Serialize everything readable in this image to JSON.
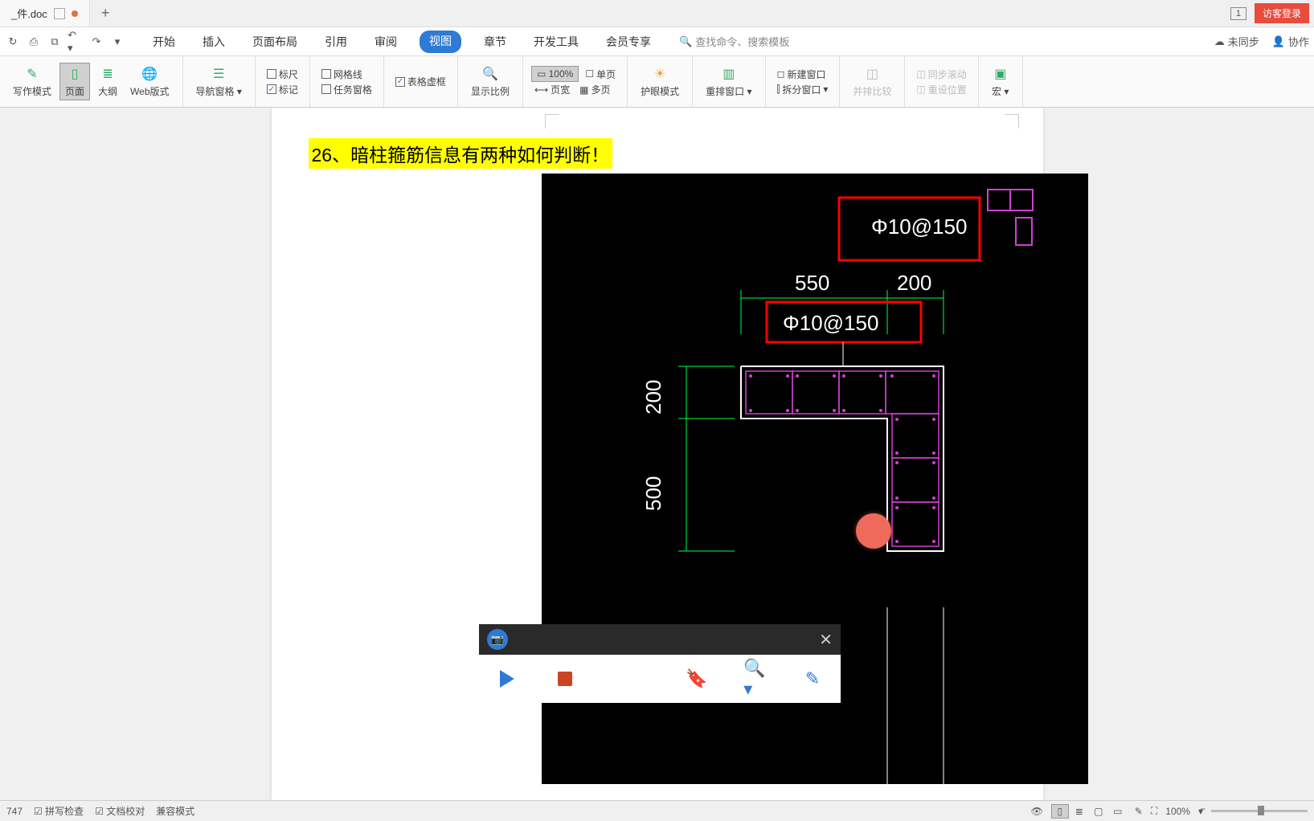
{
  "tab": {
    "filename": "_件.doc"
  },
  "login_btn": "访客登录",
  "badge1": "1",
  "menu": {
    "tabs": [
      "开始",
      "插入",
      "页面布局",
      "引用",
      "审阅",
      "视图",
      "章节",
      "开发工具",
      "会员专享"
    ],
    "active_index": 5,
    "search_placeholder": "查找命令、搜索模板",
    "unsync": "未同步",
    "collab": "协作"
  },
  "ribbon": {
    "write_mode": "写作模式",
    "page": "页面",
    "outline": "大纲",
    "web": "Web版式",
    "nav_pane": "导航窗格",
    "ruler": "标尺",
    "grid": "网格线",
    "table_dashed": "表格虚框",
    "markup": "标记",
    "task_pane": "任务窗格",
    "zoom_ratio": "显示比例",
    "zoom_value": "100%",
    "single_page": "单页",
    "page_width": "页宽",
    "multi_page": "多页",
    "eye_care": "护眼模式",
    "rearrange": "重排窗口",
    "new_window": "新建窗口",
    "split_window": "拆分窗口",
    "compare": "并排比较",
    "sync_scroll": "同步滚动",
    "reset_pos": "重设位置",
    "macro": "宏"
  },
  "doc": {
    "highlight_text": "26、暗柱箍筋信息有两种如何判断！",
    "cad_labels": {
      "phi1": "Φ10@150",
      "phi2": "Φ10@150",
      "dim550": "550",
      "dim200_h": "200",
      "dim200_v": "200",
      "dim500": "500"
    }
  },
  "status": {
    "page_num": "747",
    "spell": "拼写检查",
    "proof": "文档校对",
    "compat": "兼容模式",
    "zoom": "100%"
  }
}
